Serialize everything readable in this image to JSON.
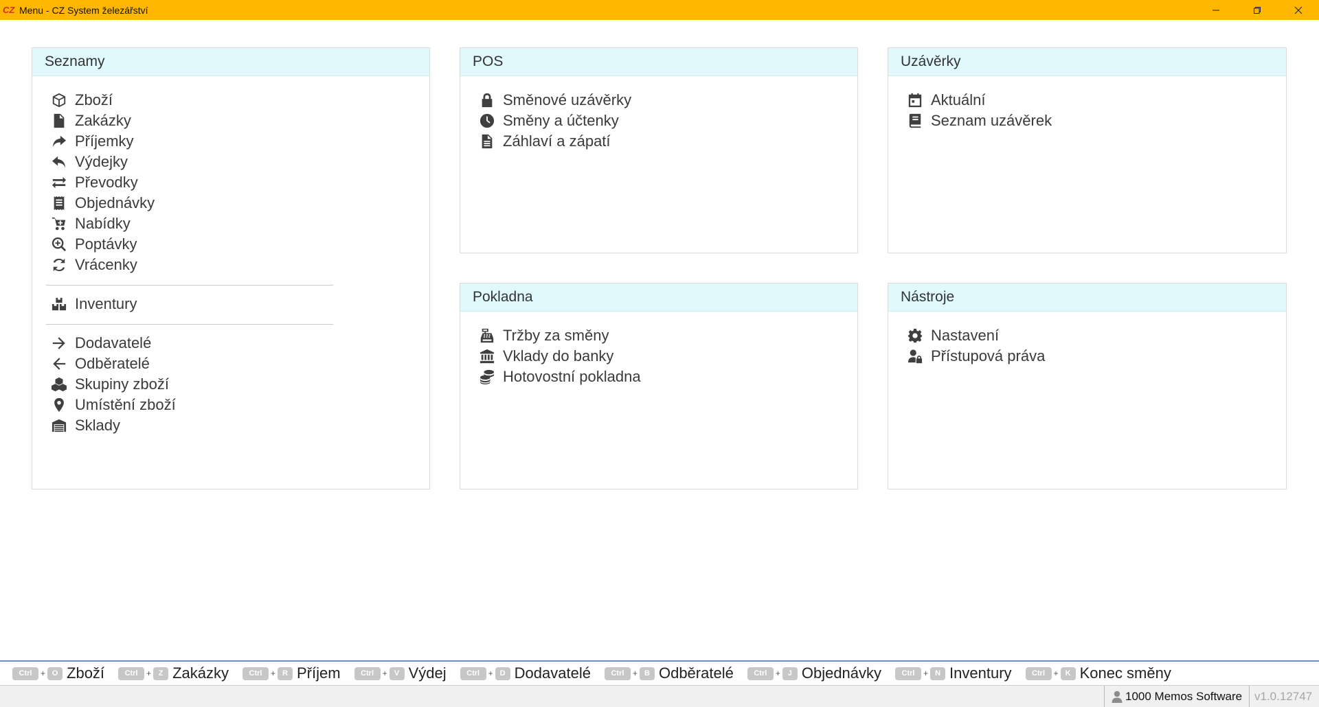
{
  "window": {
    "logo_text": "CZ",
    "title": "Menu - CZ System železářství"
  },
  "cards": {
    "seznamy": {
      "title": "Seznamy",
      "items": [
        {
          "label": "Zboží",
          "icon": "box-icon"
        },
        {
          "label": "Zakázky",
          "icon": "file-signature-icon"
        },
        {
          "label": "Příjemky",
          "icon": "share-arrow-icon"
        },
        {
          "label": "Výdejky",
          "icon": "reply-arrow-icon"
        },
        {
          "label": "Převodky",
          "icon": "exchange-arrows-icon"
        },
        {
          "label": "Objednávky",
          "icon": "receipt-icon"
        },
        {
          "label": "Nabídky",
          "icon": "cart-plus-icon"
        },
        {
          "label": "Poptávky",
          "icon": "search-plus-icon"
        },
        {
          "label": "Vrácenky",
          "icon": "sync-icon"
        },
        {
          "label": "Inventury",
          "icon": "boxes-icon"
        },
        {
          "label": "Dodavatelé",
          "icon": "arrow-right-icon"
        },
        {
          "label": "Odběratelé",
          "icon": "arrow-left-icon"
        },
        {
          "label": "Skupiny zboží",
          "icon": "cubes-icon"
        },
        {
          "label": "Umístění zboží",
          "icon": "map-marker-icon"
        },
        {
          "label": "Sklady",
          "icon": "warehouse-icon"
        }
      ]
    },
    "pos": {
      "title": "POS",
      "items": [
        {
          "label": "Směnové uzávěrky",
          "icon": "lock-icon"
        },
        {
          "label": "Směny a účtenky",
          "icon": "clock-icon"
        },
        {
          "label": "Záhlaví a zápatí",
          "icon": "file-text-icon"
        }
      ]
    },
    "uzaverky": {
      "title": "Uzávěrky",
      "items": [
        {
          "label": "Aktuální",
          "icon": "calendar-icon"
        },
        {
          "label": "Seznam uzávěrek",
          "icon": "book-icon"
        }
      ]
    },
    "pokladna": {
      "title": "Pokladna",
      "items": [
        {
          "label": "Tržby za směny",
          "icon": "cash-register-icon"
        },
        {
          "label": "Vklady do banky",
          "icon": "bank-icon"
        },
        {
          "label": "Hotovostní pokladna",
          "icon": "coins-icon"
        }
      ]
    },
    "nastroje": {
      "title": "Nástroje",
      "items": [
        {
          "label": "Nastavení",
          "icon": "gear-icon"
        },
        {
          "label": "Přístupová práva",
          "icon": "user-lock-icon"
        }
      ]
    }
  },
  "shortcuts": [
    {
      "mod": "Ctrl",
      "key": "O",
      "label": "Zboží"
    },
    {
      "mod": "Ctrl",
      "key": "Z",
      "label": "Zakázky"
    },
    {
      "mod": "Ctrl",
      "key": "R",
      "label": "Příjem"
    },
    {
      "mod": "Ctrl",
      "key": "V",
      "label": "Výdej"
    },
    {
      "mod": "Ctrl",
      "key": "D",
      "label": "Dodavatelé"
    },
    {
      "mod": "Ctrl",
      "key": "B",
      "label": "Odběratelé"
    },
    {
      "mod": "Ctrl",
      "key": "J",
      "label": "Objednávky"
    },
    {
      "mod": "Ctrl",
      "key": "N",
      "label": "Inventury"
    },
    {
      "mod": "Ctrl",
      "key": "K",
      "label": "Konec směny"
    }
  ],
  "shortcut_plus": "+",
  "status": {
    "user": "1000 Memos Software",
    "version": "v1.0.12747"
  },
  "colors": {
    "titlebar": "#ffb700",
    "card_header": "#dff9fd",
    "icon": "#404040",
    "key_badge": "#c7c7c7",
    "shortcut_bar_border": "#6a8ec8"
  }
}
